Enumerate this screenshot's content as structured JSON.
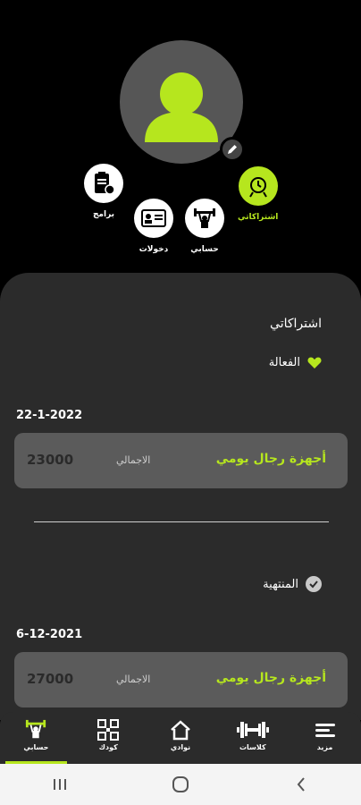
{
  "profile": {
    "avatar_icon": "user-icon",
    "edit_icon": "pencil-icon"
  },
  "quick_actions": [
    {
      "label": "اشتراكاتي",
      "icon": "clock-badge-icon",
      "active": true
    },
    {
      "label": "حسابي",
      "icon": "weightlifter-icon",
      "active": false
    },
    {
      "label": "دخولات",
      "icon": "id-card-icon",
      "active": false
    },
    {
      "label": "برامج",
      "icon": "clipboard-apple-icon",
      "active": false
    }
  ],
  "subscriptions": {
    "title": "اشتراكاتي",
    "active_label": "الفعالة",
    "expired_label": "المنتهية",
    "total_label": "الاجمالي",
    "items": [
      {
        "date": "22-1-2022",
        "name": "أجهزة رجال يومي",
        "total": "23000"
      },
      {
        "date": "6-12-2021",
        "name": "أجهزة رجال يومي",
        "total": "27000"
      }
    ]
  },
  "bottom_nav": [
    {
      "label": "مزيد",
      "icon": "menu-lines-icon"
    },
    {
      "label": "كلاسات",
      "icon": "dumbbell-icon"
    },
    {
      "label": "نوادي",
      "icon": "home-icon"
    },
    {
      "label": "كودك",
      "icon": "qr-code-icon"
    },
    {
      "label": "حسابي",
      "icon": "weightlifter-icon",
      "active": true
    }
  ],
  "colors": {
    "accent": "#b6e61e",
    "panel": "#2b2b2b",
    "card": "#5b5b5b"
  }
}
